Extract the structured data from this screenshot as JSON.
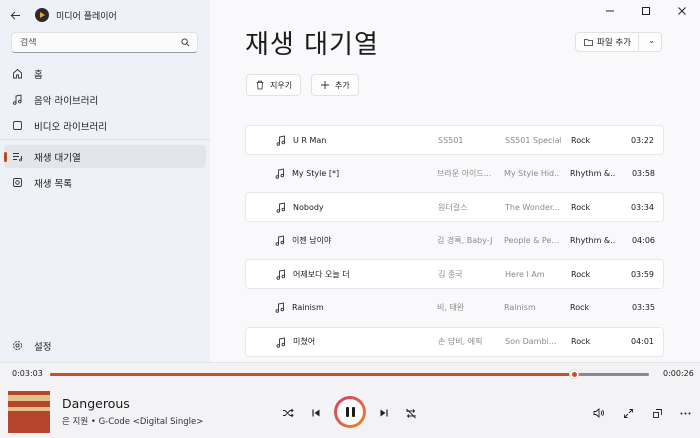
{
  "app": {
    "title": "미디어 플레이어"
  },
  "search": {
    "placeholder": "검색"
  },
  "nav": {
    "home": "홈",
    "music_library": "음악 라이브러리",
    "video_library": "비디오 라이브러리",
    "play_queue": "재생 대기열",
    "playlists": "재생 목록",
    "settings": "설정"
  },
  "main": {
    "title": "재생 대기열",
    "add_file": "파일 추가",
    "clear": "지우기",
    "add": "추가"
  },
  "tracks": [
    {
      "title": "U R Man",
      "artist": "SS501",
      "album": "SS501 Special...",
      "genre": "Rock",
      "duration": "03:22"
    },
    {
      "title": "My Style [*]",
      "artist": "브라운 아이드...",
      "album": "My Style Hid...",
      "genre": "Rhythm &...",
      "duration": "03:58"
    },
    {
      "title": "Nobody",
      "artist": "원더걸스",
      "album": "The Wonder...",
      "genre": "Rock",
      "duration": "03:34"
    },
    {
      "title": "이젠 남이야",
      "artist": "김 경록, Baby-J",
      "album": "People & Pe...",
      "genre": "Rhythm &...",
      "duration": "04:06"
    },
    {
      "title": "어제보다 오늘 더",
      "artist": "김 종국",
      "album": "Here I Am",
      "genre": "Rock",
      "duration": "03:59"
    },
    {
      "title": "Rainism",
      "artist": "비, 태완",
      "album": "Rainism",
      "genre": "Rock",
      "duration": "03:35"
    },
    {
      "title": "미쳤어",
      "artist": "손 담비, 에픽",
      "album": "Son Dambi...",
      "genre": "Rock",
      "duration": "04:01"
    }
  ],
  "player": {
    "elapsed": "0:03:03",
    "remaining": "0:00:26",
    "progress": 0.875,
    "song_title": "Dangerous",
    "song_artist": "은 지원 • G-Code <Digital Single>",
    "accent": "#c4512a"
  }
}
